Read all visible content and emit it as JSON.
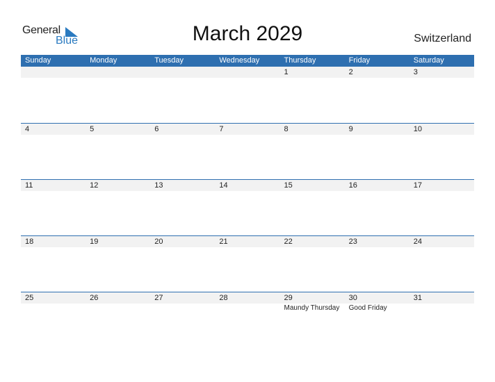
{
  "logo": {
    "word1": "General",
    "word2": "Blue"
  },
  "title": "March 2029",
  "country": "Switzerland",
  "weekdays": [
    "Sunday",
    "Monday",
    "Tuesday",
    "Wednesday",
    "Thursday",
    "Friday",
    "Saturday"
  ],
  "weeks": [
    {
      "days": [
        "",
        "",
        "",
        "",
        "1",
        "2",
        "3"
      ],
      "holidays": [
        "",
        "",
        "",
        "",
        "",
        "",
        ""
      ]
    },
    {
      "days": [
        "4",
        "5",
        "6",
        "7",
        "8",
        "9",
        "10"
      ],
      "holidays": [
        "",
        "",
        "",
        "",
        "",
        "",
        ""
      ]
    },
    {
      "days": [
        "11",
        "12",
        "13",
        "14",
        "15",
        "16",
        "17"
      ],
      "holidays": [
        "",
        "",
        "",
        "",
        "",
        "",
        ""
      ]
    },
    {
      "days": [
        "18",
        "19",
        "20",
        "21",
        "22",
        "23",
        "24"
      ],
      "holidays": [
        "",
        "",
        "",
        "",
        "",
        "",
        ""
      ]
    },
    {
      "days": [
        "25",
        "26",
        "27",
        "28",
        "29",
        "30",
        "31"
      ],
      "holidays": [
        "",
        "",
        "",
        "",
        "Maundy Thursday",
        "Good Friday",
        ""
      ]
    }
  ],
  "colors": {
    "accent": "#2e6fb0",
    "day_bar": "#f2f2f2",
    "logo_blue": "#2a7ac0"
  }
}
